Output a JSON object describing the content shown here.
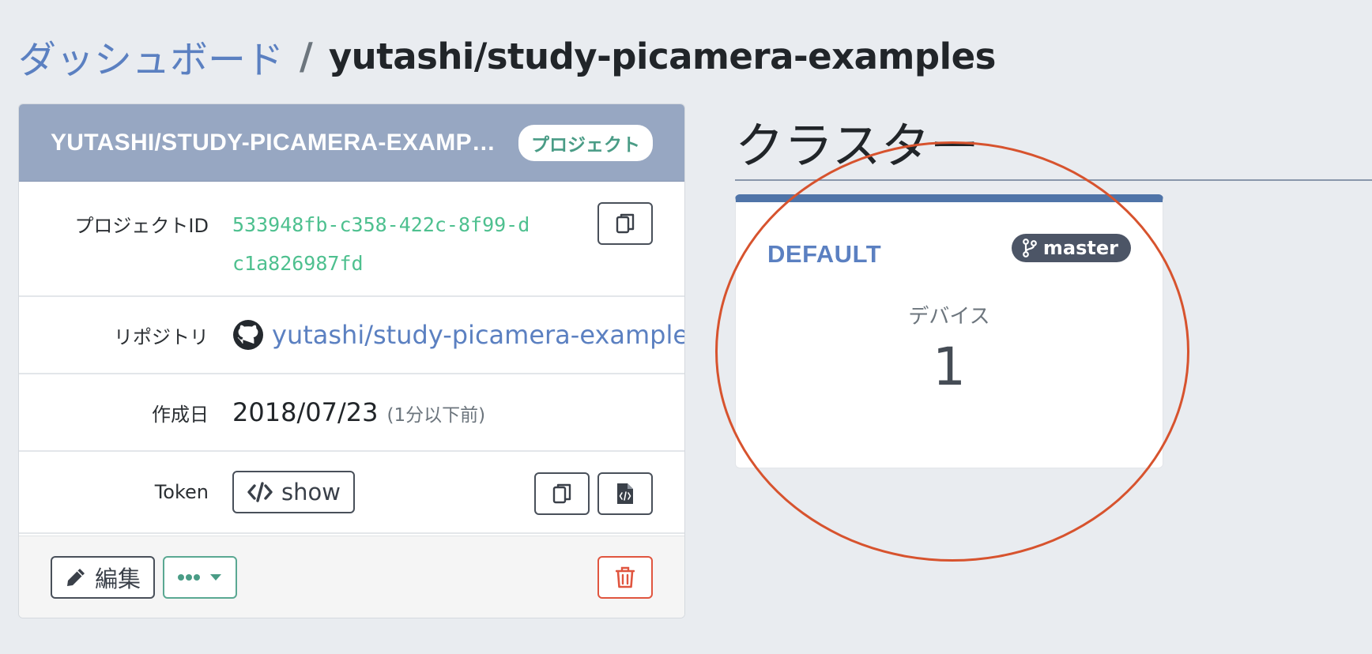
{
  "breadcrumb": {
    "dashboard_link": "ダッシュボード",
    "separator": "/",
    "current": "yutashi/study-picamera-examples"
  },
  "project": {
    "title": "YUTASHI/STUDY-PICAMERA-EXAMPLES",
    "badge": "プロジェクト",
    "id_label": "プロジェクトID",
    "id_value": "533948fb-c358-422c-8f99-dc1a826987fd",
    "repo_label": "リポジトリ",
    "repo_value": "yutashi/study-picamera-examples",
    "created_label": "作成日",
    "created_value": "2018/07/23",
    "created_relative": "(1分以下前)",
    "token_label": "Token",
    "token_show": "show",
    "edit_label": "編集"
  },
  "cluster": {
    "heading": "クラスター",
    "name": "DEFAULT",
    "branch": "master",
    "device_label": "デバイス",
    "device_count": "1"
  },
  "colors": {
    "header_bg": "#97a7c2",
    "link": "#5b80c1",
    "id_text": "#4ec08f",
    "cluster_accent": "#4f74a8",
    "delete": "#e0553f",
    "annotation": "#d7532e"
  },
  "icons": {
    "copy": "copy-icon",
    "code": "code-icon",
    "code_file": "code-file-icon",
    "github": "github-icon",
    "pencil": "pencil-icon",
    "dots": "ellipsis-icon",
    "caret": "caret-down-icon",
    "trash": "trash-icon",
    "branch": "git-branch-icon"
  }
}
